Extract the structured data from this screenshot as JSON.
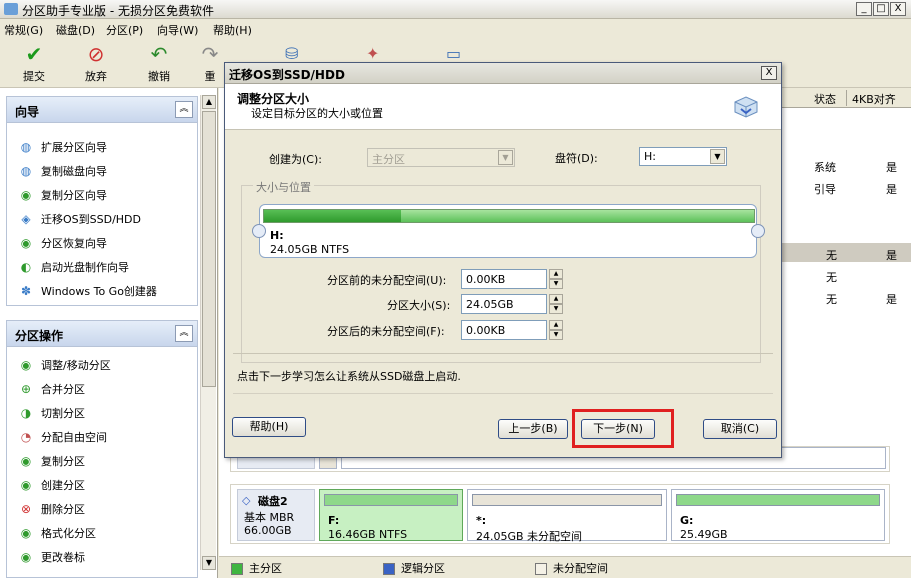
{
  "app": {
    "title": "分区助手专业版 - 无损分区免费软件",
    "window_buttons": [
      "_",
      "□",
      "X"
    ]
  },
  "menu": [
    "常规(G)",
    "磁盘(D)",
    "分区(P)",
    "向导(W)",
    "帮助(H)"
  ],
  "toolbar": {
    "commit": "提交",
    "discard": "放弃",
    "undo": "撤销",
    "redo": "重"
  },
  "wizard_panel": {
    "title": "向导",
    "items": [
      {
        "label": "扩展分区向导",
        "icon": "expand-partition-icon"
      },
      {
        "label": "复制磁盘向导",
        "icon": "copy-disk-icon"
      },
      {
        "label": "复制分区向导",
        "icon": "copy-partition-icon"
      },
      {
        "label": "迁移OS到SSD/HDD",
        "icon": "migrate-os-icon"
      },
      {
        "label": "分区恢复向导",
        "icon": "partition-recovery-icon"
      },
      {
        "label": "启动光盘制作向导",
        "icon": "boot-cd-icon"
      },
      {
        "label": "Windows To Go创建器",
        "icon": "windows-to-go-icon"
      }
    ]
  },
  "ops_panel": {
    "title": "分区操作",
    "items": [
      {
        "label": "调整/移动分区",
        "icon": "resize-move-icon"
      },
      {
        "label": "合并分区",
        "icon": "merge-icon"
      },
      {
        "label": "切割分区",
        "icon": "split-icon"
      },
      {
        "label": "分配自由空间",
        "icon": "allocate-space-icon"
      },
      {
        "label": "复制分区",
        "icon": "copy-icon"
      },
      {
        "label": "创建分区",
        "icon": "create-icon"
      },
      {
        "label": "删除分区",
        "icon": "delete-icon"
      },
      {
        "label": "格式化分区",
        "icon": "format-icon"
      },
      {
        "label": "更改卷标",
        "icon": "change-label-icon"
      }
    ]
  },
  "grid": {
    "headers": [
      "状态",
      "4KB对齐"
    ],
    "rows": [
      {
        "status": "系统",
        "aligned": "是"
      },
      {
        "status": "引导",
        "aligned": "是"
      },
      {
        "status": "无",
        "aligned": "是"
      },
      {
        "status": "无",
        "aligned": ""
      },
      {
        "status": "无",
        "aligned": "是"
      }
    ]
  },
  "disk2": {
    "name": "磁盘2",
    "type": "基本 MBR",
    "size": "66.00GB",
    "partitions": [
      {
        "name": "F:",
        "size": "16.46GB NTFS",
        "color": "#8ed88a"
      },
      {
        "name": "*:",
        "size": "24.05GB 未分配空间",
        "color": "#e8e4d8"
      },
      {
        "name": "G:",
        "size": "25.49GB",
        "color": "#8ed88a"
      }
    ]
  },
  "legend": [
    {
      "label": "主分区",
      "color": "#3fb540"
    },
    {
      "label": "逻辑分区",
      "color": "#3a63c4"
    },
    {
      "label": "未分配空间",
      "color": "#f4f1e6"
    }
  ],
  "dialog": {
    "title": "迁移OS到SSD/HDD",
    "close": "X",
    "header_title": "调整分区大小",
    "header_subtitle": "设定目标分区的大小或位置",
    "create_as_label": "创建为(C):",
    "create_as_value": "主分区",
    "drive_letter_label": "盘符(D):",
    "drive_letter_value": "H:",
    "group_label": "大小与位置",
    "partition_name": "H:",
    "partition_size": "24.05GB NTFS",
    "used_fraction": 0.28,
    "before_label": "分区前的未分配空间(U):",
    "before_value": "0.00KB",
    "size_label": "分区大小(S):",
    "size_value": "24.05GB",
    "after_label": "分区后的未分配空间(F):",
    "after_value": "0.00KB",
    "hint": "点击下一步学习怎么让系统从SSD磁盘上启动.",
    "help_button": "帮助(H)",
    "prev_button": "上一步(B)",
    "next_button": "下一步(N)",
    "cancel_button": "取消(C)"
  },
  "colors": {
    "highlight": "#e02020",
    "primary_green": "#3fb540"
  }
}
